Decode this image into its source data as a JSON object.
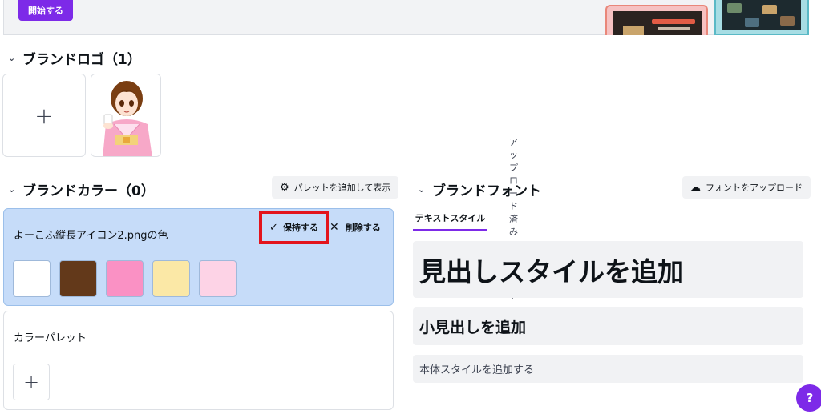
{
  "banner": {
    "start_label": "開始する"
  },
  "logo_section": {
    "title": "ブランドロゴ（1）"
  },
  "color_section": {
    "title": "ブランドカラー（0）",
    "add_palette_label": "パレットを追加して表示",
    "palette": {
      "name": "よーこふ縦長アイコン2.pngの色",
      "keep_label": "保持する",
      "delete_label": "削除する",
      "swatches": [
        "#ffffff",
        "#63391a",
        "#fa91c4",
        "#fbe8a6",
        "#fdd3e6"
      ]
    },
    "color_palette_label": "カラーパレット"
  },
  "font_section": {
    "title": "ブランドフォント",
    "upload_label": "フォントをアップロード",
    "tabs": [
      "テキストスタイル",
      "アップロード済みのフォント"
    ],
    "heading_label": "見出しスタイルを追加",
    "subheading_label": "小見出しを追加",
    "body_label": "本体スタイルを追加する"
  },
  "help_label": "?",
  "colors": {
    "accent": "#7d2ae8",
    "highlight": "#e3141c",
    "palette_bg": "#c6dcf9"
  },
  "icons": [
    "chevron-down-icon",
    "plus-icon",
    "palette-icon",
    "check-icon",
    "close-icon",
    "cloud-upload-icon",
    "help-icon"
  ]
}
